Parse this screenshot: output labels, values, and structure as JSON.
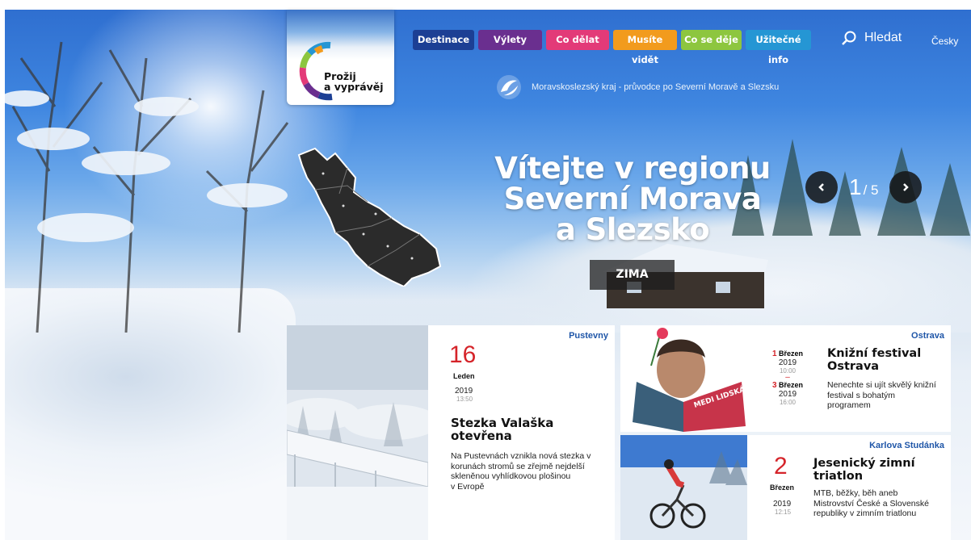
{
  "logo": {
    "text_line1": "Prožij",
    "text_line2": "a vyprávěj"
  },
  "nav": {
    "items": [
      {
        "label": "Destinace",
        "color": "#1c3f94"
      },
      {
        "label": "Výlety",
        "color": "#6a2f8f"
      },
      {
        "label": "Co dělat",
        "color": "#e33a78"
      },
      {
        "label": "Musíte vidět",
        "color": "#f29b1d"
      },
      {
        "label": "Co se děje",
        "color": "#8dc63f"
      },
      {
        "label": "Užitečné info",
        "color": "#2596d4"
      }
    ],
    "search_label": "Hledat",
    "language": "Česky"
  },
  "tagline": "Moravskoslezský kraj - průvodce po Severní Moravě a Slezsku",
  "hero": {
    "headline_line1": "Vítejte v regionu",
    "headline_line2": "Severní Morava",
    "headline_line3": "a Slezsko",
    "season": "ZIMA"
  },
  "slider": {
    "current": "1",
    "total": "/ 5",
    "prev_icon": "chevron-left-icon",
    "next_icon": "chevron-right-icon"
  },
  "cards": [
    {
      "place": "Pustevny",
      "day": "16",
      "month": "Leden",
      "year": "2019",
      "time": "13:50",
      "title_line1": "Stezka Valaška",
      "title_line2": "otevřena",
      "desc_line1": "Na Pustevnách vznikla nová stezka v",
      "desc_line2": "korunách stromů se zřejmě nejdelší",
      "desc_line3": "skleněnou vyhlídkovou plošinou",
      "desc_line4": "v Evropě"
    },
    {
      "place": "Ostrava",
      "start_day": "1",
      "start_month": "Březen",
      "start_year": "2019",
      "start_time": "10:00",
      "end_day": "3",
      "end_month": "Březen",
      "end_year": "2019",
      "end_time": "16:00",
      "title_line1": "Knižní festival",
      "title_line2": "Ostrava",
      "desc_line1": "Nenechte si ujít skvělý knižní",
      "desc_line2": "festival s bohatým",
      "desc_line3": "programem",
      "book_text": "MEDI LIDSKÁ FA"
    },
    {
      "place": "Karlova Studánka",
      "day": "2",
      "month": "Březen",
      "year": "2019",
      "time": "12:15",
      "title_line1": "Jesenický zimní",
      "title_line2": "triatlon",
      "desc_line1": "MTB, běžky, běh aneb",
      "desc_line2": "Mistrovství České a Slovenské",
      "desc_line3": "republiky v zimním triatlonu"
    }
  ],
  "colors": {
    "accent_red": "#d5242a",
    "place_blue": "#1f56a8"
  }
}
